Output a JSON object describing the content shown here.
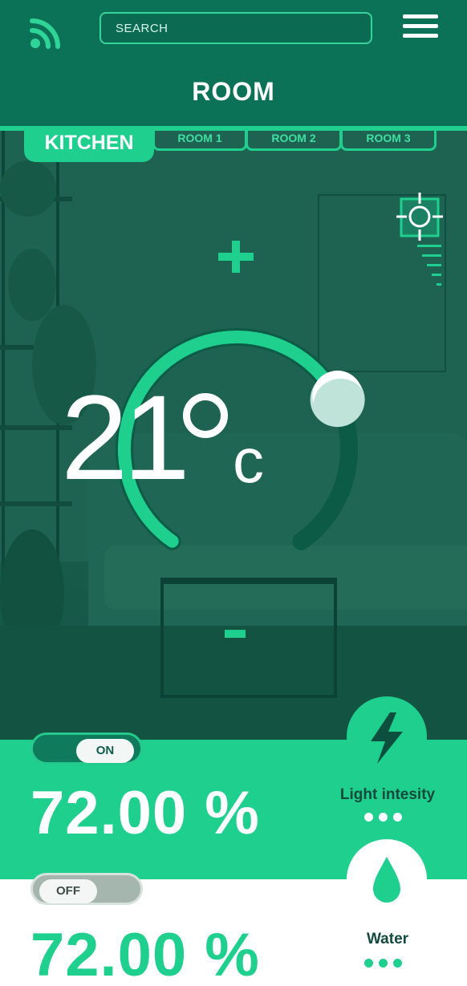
{
  "header": {
    "search_placeholder": "SEARCH",
    "title": "ROOM",
    "menu_icon": "hamburger-menu-icon",
    "wifi_icon": "wifi-signal-icon"
  },
  "tabs": [
    {
      "label": "KITCHEN",
      "active": true
    },
    {
      "label": "ROOM 1",
      "active": false
    },
    {
      "label": "ROOM 2",
      "active": false
    },
    {
      "label": "ROOM 3",
      "active": false
    }
  ],
  "thermostat": {
    "increase_icon": "plus-icon",
    "decrease_icon": "minus-icon",
    "temperature": "21",
    "unit": "c",
    "level_fraction": 0.72,
    "target_icon": "crosshair-target-icon"
  },
  "light": {
    "toggle_label": "ON",
    "value": "72.00 %",
    "label": "Light intesity",
    "icon": "lightning-bolt-icon"
  },
  "water": {
    "toggle_label": "OFF",
    "value": "72.00 %",
    "label": "Water",
    "icon": "water-drop-icon"
  },
  "colors": {
    "accent": "#1fcf8e",
    "header": "#0b7258",
    "text_dark": "#134a3b"
  }
}
